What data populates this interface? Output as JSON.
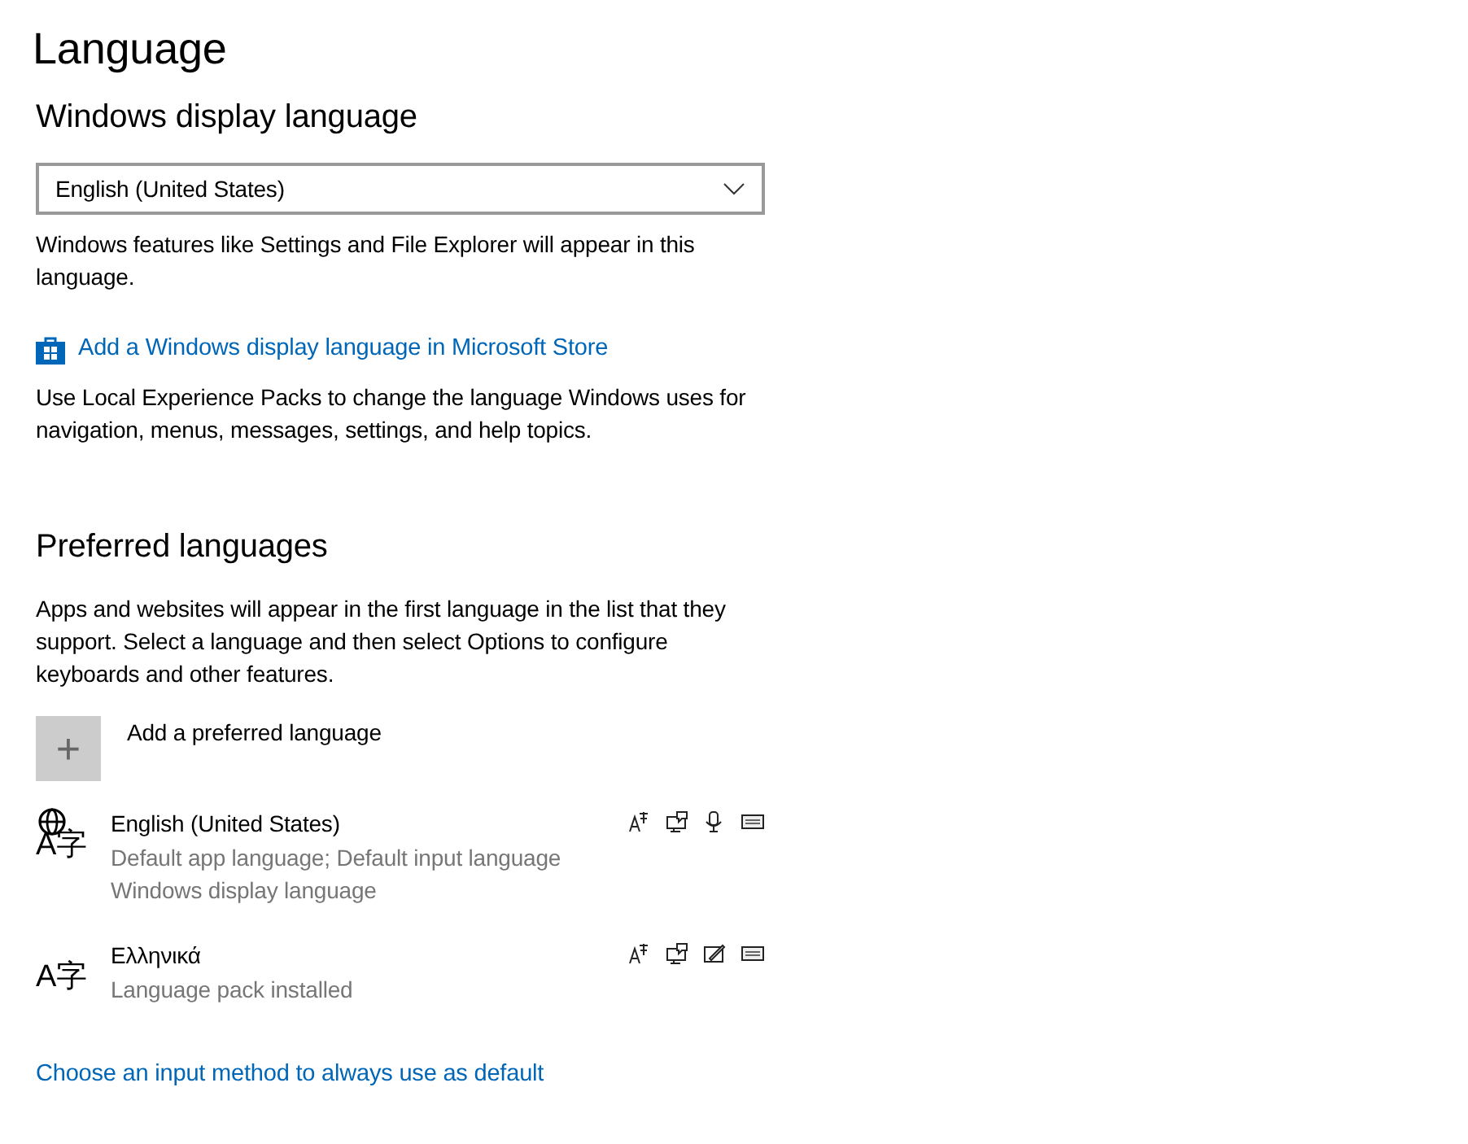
{
  "page_title": "Language",
  "display_language": {
    "heading": "Windows display language",
    "dropdown_value": "English (United States)",
    "description": "Windows features like Settings and File Explorer will appear in this language.",
    "store_link": "Add a Windows display language in Microsoft Store",
    "store_description": "Use Local Experience Packs to change the language Windows uses for navigation, menus, messages, settings, and help topics."
  },
  "preferred_languages": {
    "heading": "Preferred languages",
    "description": "Apps and websites will appear in the first language in the list that they support. Select a language and then select Options to configure keyboards and other features.",
    "add_button": {
      "icon": "+",
      "label": "Add a preferred language"
    },
    "languages": [
      {
        "glyph": "A字",
        "display_language": true,
        "name": "English (United States)",
        "details": [
          "Default app language; Default input language",
          "Windows display language"
        ],
        "features": [
          {
            "kind": "language-pack"
          },
          {
            "kind": "text-to-speech"
          },
          {
            "kind": "speech"
          },
          {
            "kind": "keyboard"
          }
        ]
      },
      {
        "glyph": "A字",
        "display_language": false,
        "name": "Ελληνικά",
        "details": [
          "Language pack installed"
        ],
        "features": [
          {
            "kind": "language-pack"
          },
          {
            "kind": "text-to-speech"
          },
          {
            "kind": "handwriting"
          },
          {
            "kind": "keyboard"
          }
        ]
      }
    ]
  },
  "input_method_link": "Choose an input method to always use as default"
}
